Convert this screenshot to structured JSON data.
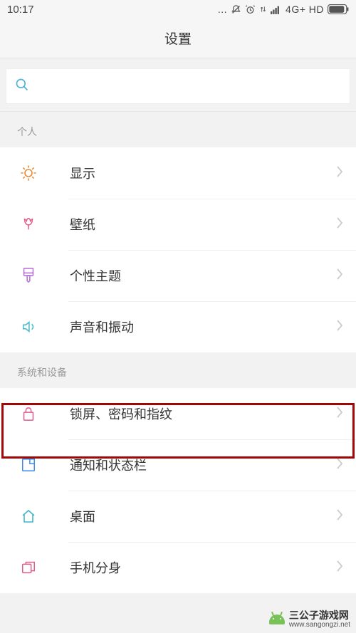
{
  "status": {
    "time": "10:17",
    "network": "4G+ HD"
  },
  "header": {
    "title": "设置"
  },
  "search": {
    "placeholder": ""
  },
  "sections": [
    {
      "title": "个人",
      "items": [
        {
          "label": "显示"
        },
        {
          "label": "壁纸"
        },
        {
          "label": "个性主题"
        },
        {
          "label": "声音和振动"
        }
      ]
    },
    {
      "title": "系统和设备",
      "items": [
        {
          "label": "锁屏、密码和指纹"
        },
        {
          "label": "通知和状态栏"
        },
        {
          "label": "桌面"
        },
        {
          "label": "手机分身"
        }
      ]
    }
  ],
  "watermark": {
    "name": "三公子游戏网",
    "url": "www.sangongzi.net"
  },
  "colors": {
    "display": "#e88b3a",
    "wallpaper": "#e05a8a",
    "theme": "#b36ad8",
    "sound": "#3fb8c9",
    "lock": "#e05a8a",
    "notif": "#3a8be8",
    "home": "#3fb8c9",
    "dual": "#e05a8a"
  }
}
